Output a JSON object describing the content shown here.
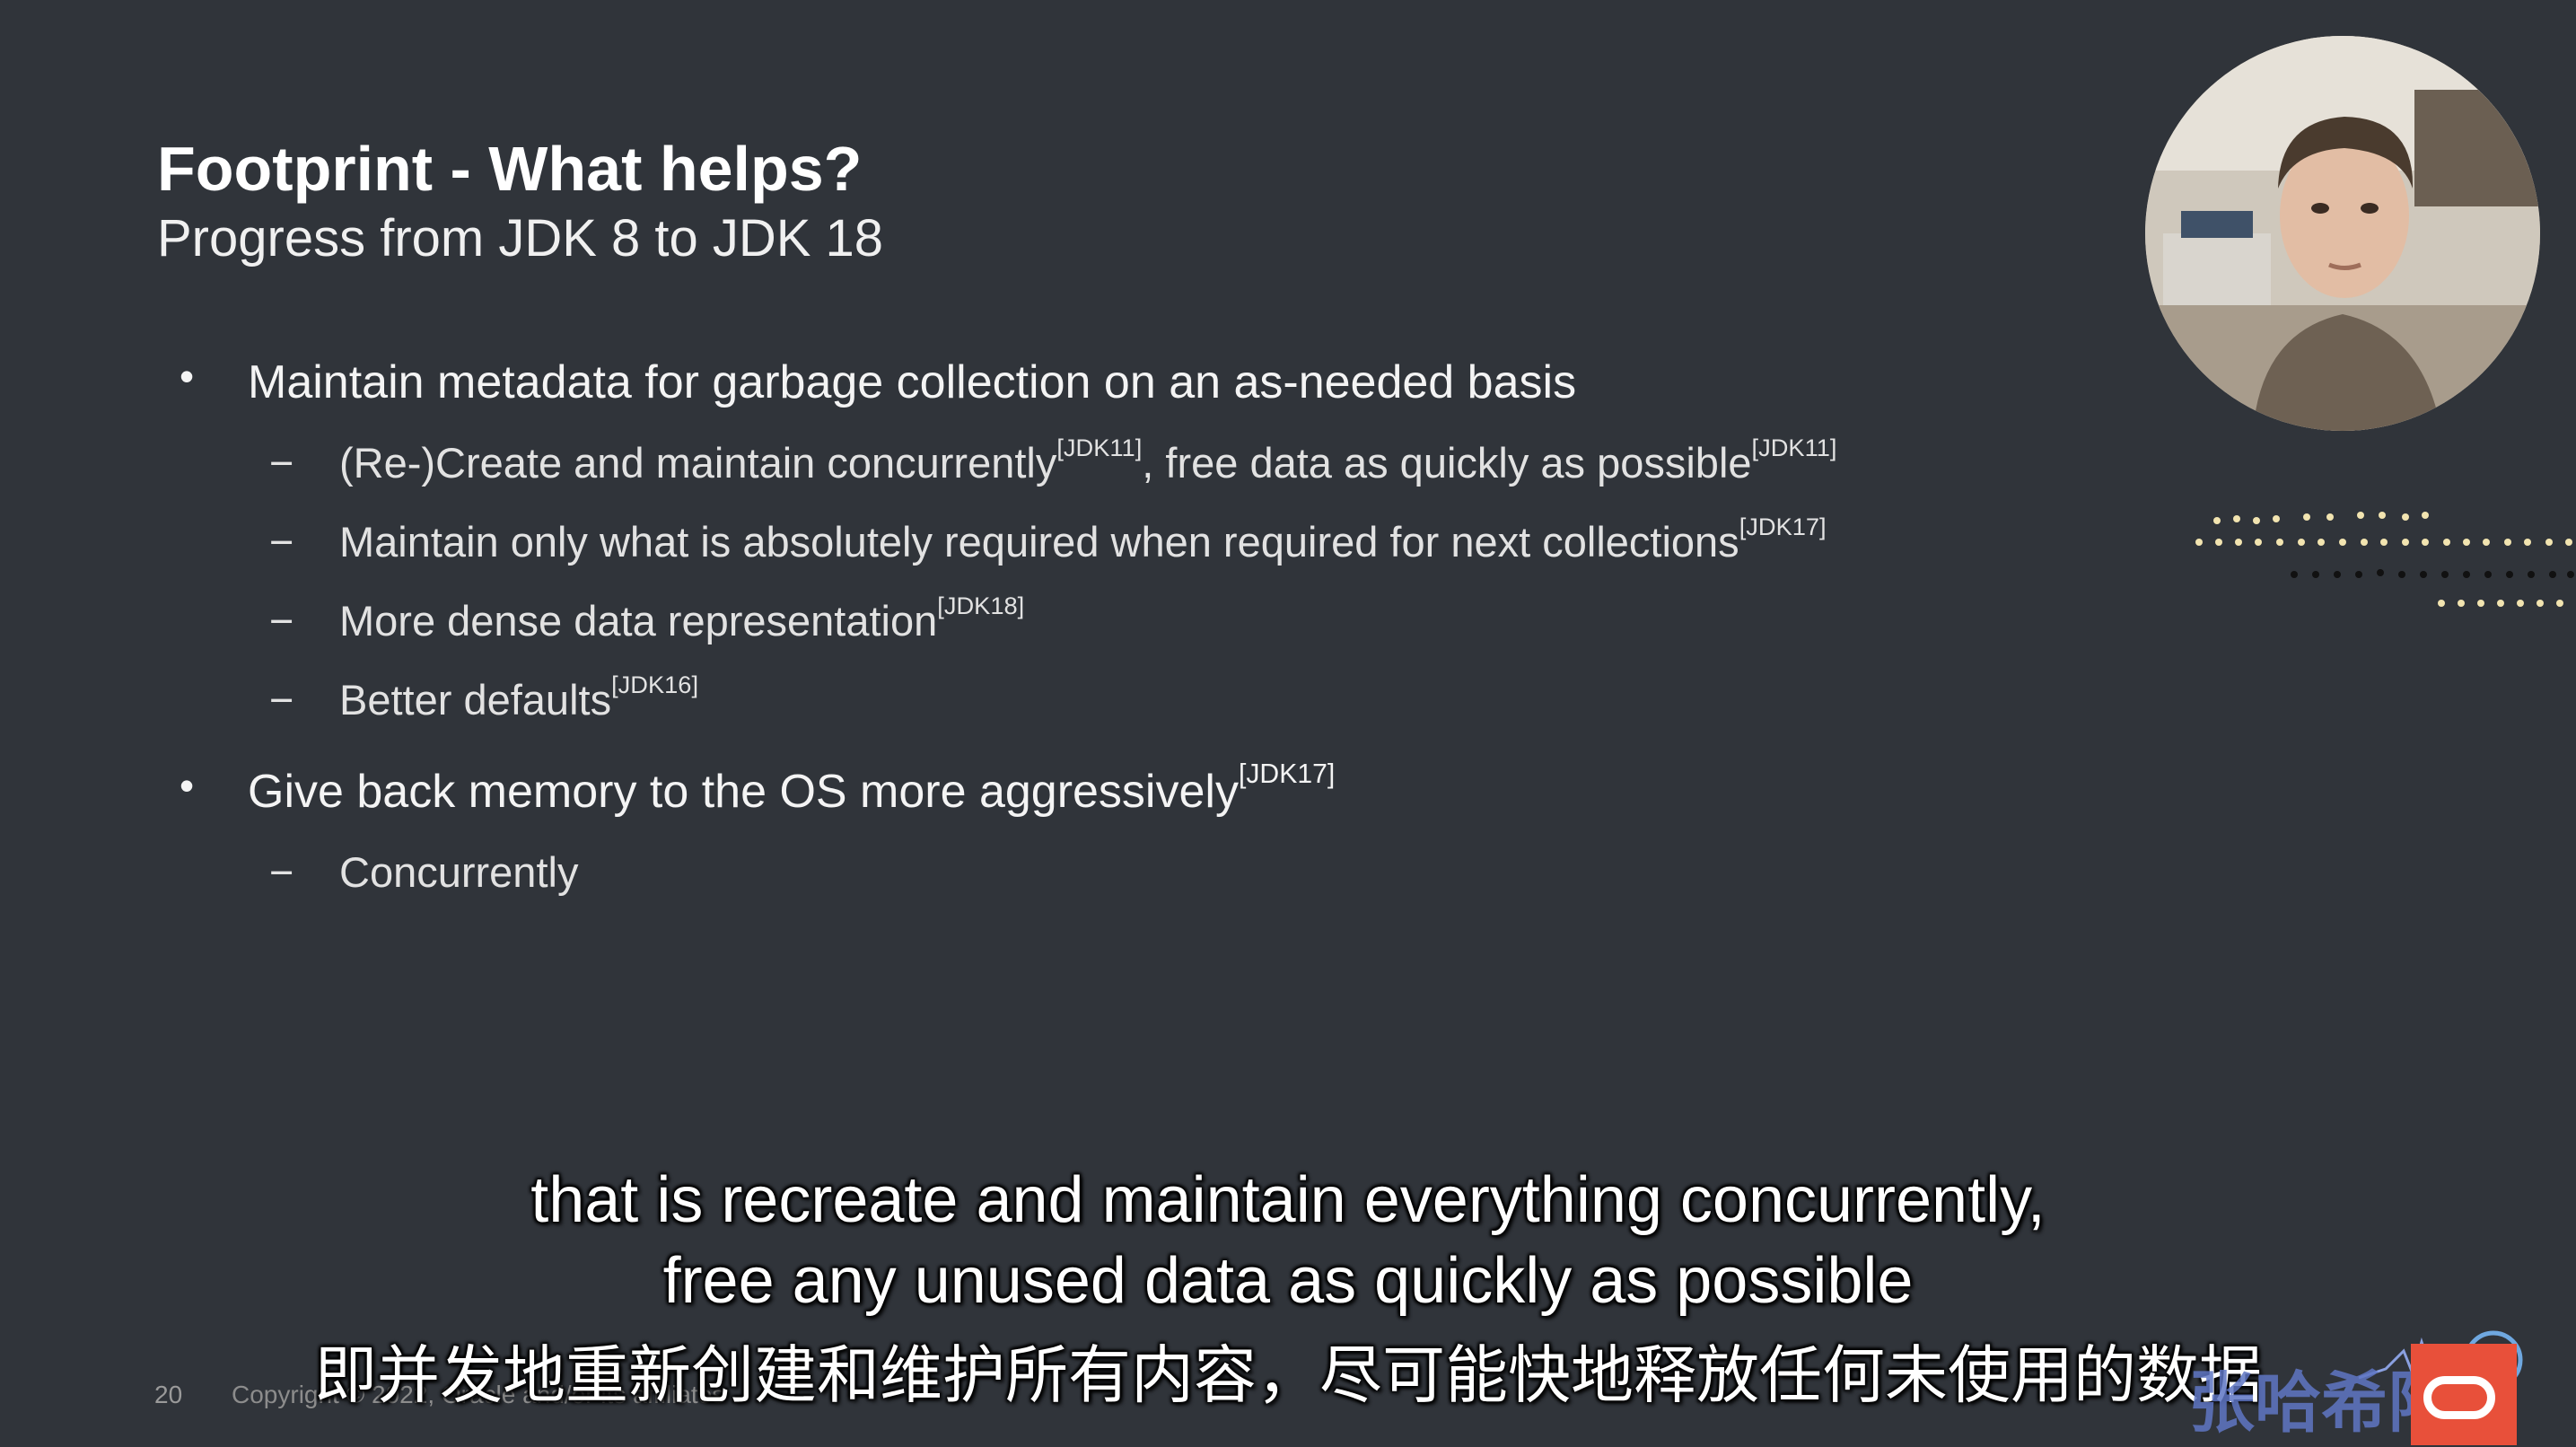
{
  "slide": {
    "title": "Footprint - What helps?",
    "subtitle": "Progress from JDK 8 to JDK 18",
    "bullets": [
      {
        "text": "Maintain metadata for garbage collection on an as-needed basis",
        "sub": [
          {
            "parts": [
              "(Re-)Create and maintain concurrently",
              "[JDK11]",
              ", free data as quickly as possible",
              "[JDK11]"
            ]
          },
          {
            "parts": [
              "Maintain only what is absolutely required when required for next collections",
              "[JDK17]"
            ]
          },
          {
            "parts": [
              "More dense data representation",
              "[JDK18]"
            ]
          },
          {
            "parts": [
              "Better defaults",
              "[JDK16]"
            ]
          }
        ]
      },
      {
        "text": "Give back memory to  the OS more aggressively",
        "sup": "[JDK17]",
        "sub": [
          {
            "parts": [
              "Concurrently"
            ]
          }
        ]
      }
    ],
    "bullet_glyph": "•",
    "dash_glyph": "−",
    "page_number": "20",
    "copyright": "Copyright © 2022, Oracle and/or its affiliates"
  },
  "subtitles": {
    "en_line1": "that is recreate and maintain everything concurrently,",
    "en_line2": "free any unused data as quickly as possible",
    "zh_line": "即并发地重新创建和维护所有内容，尽可能快地释放任何未使用的数据"
  },
  "watermark": {
    "text": "张哈希限制"
  },
  "colors": {
    "background": "#30343a",
    "accent_dots_light": "#f2e4b0",
    "accent_dots_dark": "#111111",
    "oracle_red": "#e8503a",
    "watermark_blue": "#5f76c4"
  },
  "icons": [
    "webcam-presenter-icon",
    "oracle-logo-icon",
    "dotted-decoration-icon"
  ]
}
